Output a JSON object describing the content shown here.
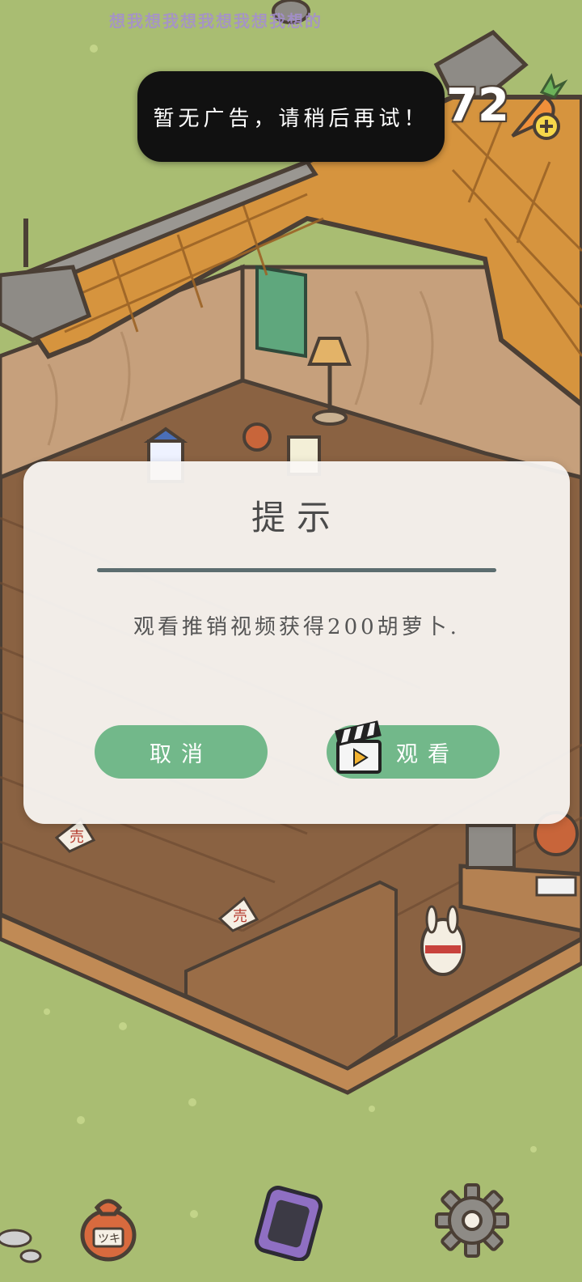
{
  "banner": {
    "text": "想我想我想我想我想我想的"
  },
  "currency": {
    "count": "72",
    "icon": "carrot-icon",
    "add_icon": "plus-icon"
  },
  "toast": {
    "message": "暂无广告，请稍后再试！"
  },
  "dialog": {
    "title": "提示",
    "message": "观看推销视频获得200胡萝卜.",
    "cancel_label": "取消",
    "watch_label": "观看",
    "watch_icon": "clapperboard-icon"
  },
  "store_signs": {
    "label": "売"
  },
  "bag": {
    "label": "ツキ"
  },
  "bottom_bar": {
    "items": [
      {
        "icon": "bag-icon"
      },
      {
        "icon": "phone-icon"
      },
      {
        "icon": "gear-icon"
      }
    ]
  },
  "colors": {
    "grass": "#a9bd72",
    "roof": "#d6943e",
    "floor": "#8a6242",
    "button": "#72b88a",
    "toast": "#111111"
  }
}
